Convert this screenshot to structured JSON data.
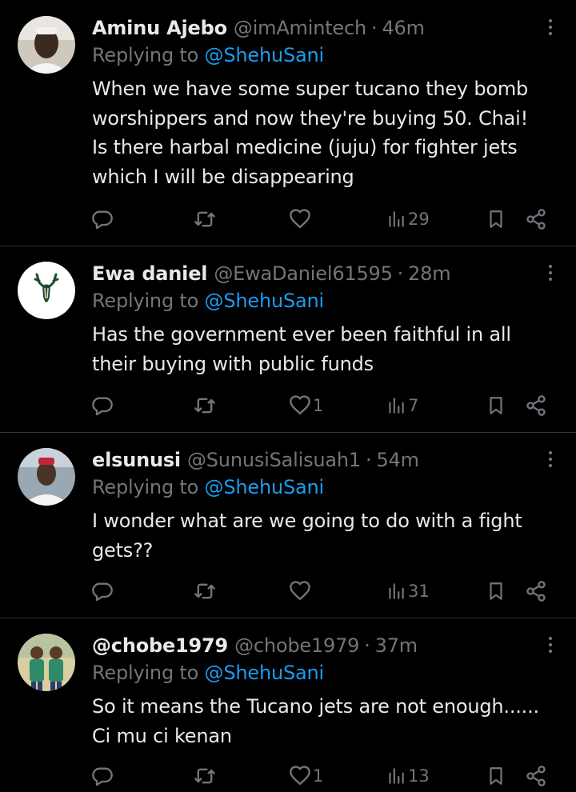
{
  "replying_prefix": "Replying to",
  "replies": [
    {
      "name": "Aminu Ajebo",
      "handle": "@imAmintech",
      "separator": "·",
      "time": "46m",
      "replying_to": "@ShehuSani",
      "lines": [
        "When we have some super tucano they bomb",
        "worshippers and now they're buying 50. Chai!",
        "Is there harbal medicine (juju) for fighter jets",
        "which I will be disappearing"
      ],
      "likes": "",
      "views": "29",
      "avatar": "photo-man-white-cap"
    },
    {
      "name": "Ewa daniel",
      "handle": "@EwaDaniel61595",
      "separator": "·",
      "time": "28m",
      "replying_to": "@ShehuSani",
      "lines": [
        "Has the government ever been faithful in all",
        "their buying with public funds"
      ],
      "likes": "1",
      "views": "7",
      "avatar": "deer-logo-green"
    },
    {
      "name": "elsunusi",
      "handle": "@SunusiSalisuah1",
      "separator": "·",
      "time": "54m",
      "replying_to": "@ShehuSani",
      "lines": [
        "I wonder what are we going to do with a fight",
        "gets??"
      ],
      "likes": "",
      "views": "31",
      "avatar": "photo-man-red-cap"
    },
    {
      "name": "@chobe1979",
      "handle": "@chobe1979",
      "separator": "·",
      "time": "37m",
      "replying_to": "@ShehuSani",
      "lines": [
        "So it means the Tucano jets are not enough......",
        "Ci mu ci kenan"
      ],
      "likes": "1",
      "views": "13",
      "avatar": "photo-two-children"
    }
  ],
  "colors": {
    "background": "#000000",
    "text": "#e7e9ea",
    "secondary": "#71767b",
    "mention": "#1d9bf0",
    "divider": "#2f3336"
  },
  "icons": [
    "more-icon",
    "reply-icon",
    "retweet-icon",
    "like-icon",
    "views-icon",
    "bookmark-icon",
    "share-icon"
  ]
}
